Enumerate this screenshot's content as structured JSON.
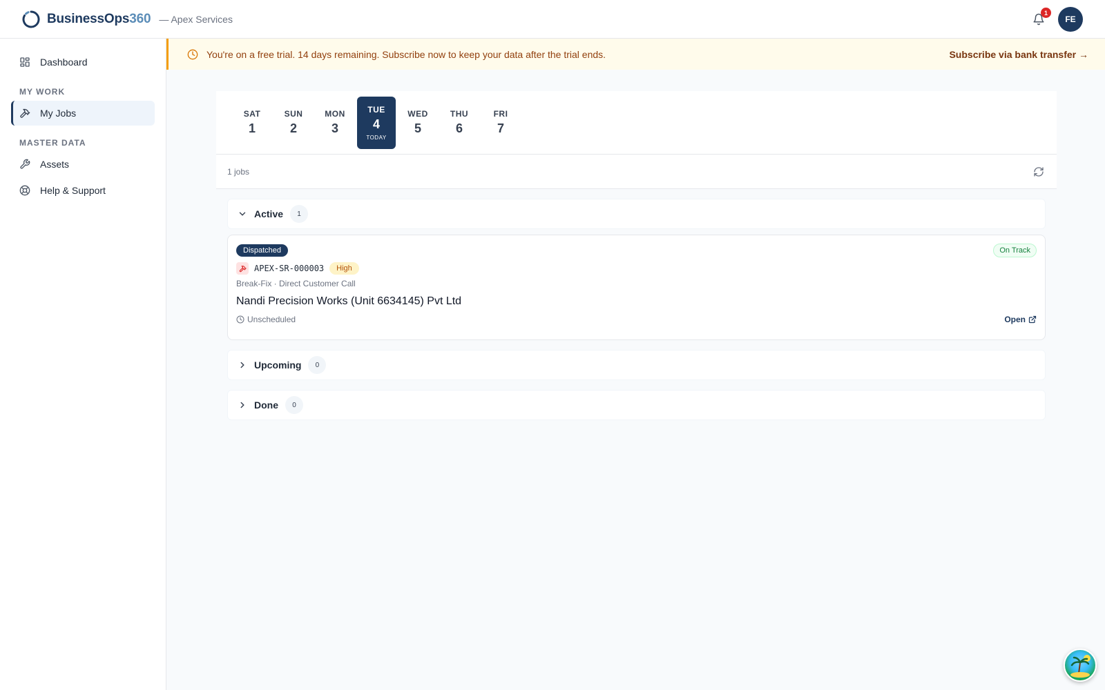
{
  "header": {
    "brand_main": "BusinessOps",
    "brand_num": "360",
    "tenant": "— Apex Services",
    "notifications_count": "1",
    "avatar_initials": "FE"
  },
  "sidebar": {
    "dashboard": "Dashboard",
    "section_my_work": "MY WORK",
    "my_jobs": "My Jobs",
    "section_master_data": "MASTER DATA",
    "assets": "Assets",
    "help": "Help & Support"
  },
  "banner": {
    "text": "You're on a free trial. 14 days remaining. Subscribe now to keep your data after the trial ends.",
    "link": "Subscribe via bank transfer →"
  },
  "days": [
    {
      "name": "SAT",
      "num": "1",
      "tag": ""
    },
    {
      "name": "SUN",
      "num": "2",
      "tag": ""
    },
    {
      "name": "MON",
      "num": "3",
      "tag": ""
    },
    {
      "name": "TUE",
      "num": "4",
      "tag": "TODAY"
    },
    {
      "name": "WED",
      "num": "5",
      "tag": ""
    },
    {
      "name": "THU",
      "num": "6",
      "tag": ""
    },
    {
      "name": "FRI",
      "num": "7",
      "tag": ""
    }
  ],
  "jobs_count": "1 jobs",
  "groups": {
    "active": {
      "title": "Active",
      "count": "1"
    },
    "upcoming": {
      "title": "Upcoming",
      "count": "0"
    },
    "done": {
      "title": "Done",
      "count": "0"
    }
  },
  "job": {
    "status": "Dispatched",
    "track": "On Track",
    "id": "APEX-SR-000003",
    "priority": "High",
    "subtitle": "Break-Fix · Direct Customer Call",
    "title": "Nandi Precision Works (Unit 6634145) Pvt Ltd",
    "schedule": "Unscheduled",
    "open": "Open"
  },
  "colors": {
    "brand": "#1e3a5f",
    "accent": "#5b8db8",
    "banner_bg": "#fffbeb",
    "banner_border": "#f59e0b",
    "on_track": "#15803d",
    "priority_high": "#b45309",
    "notification": "#dc2626"
  }
}
